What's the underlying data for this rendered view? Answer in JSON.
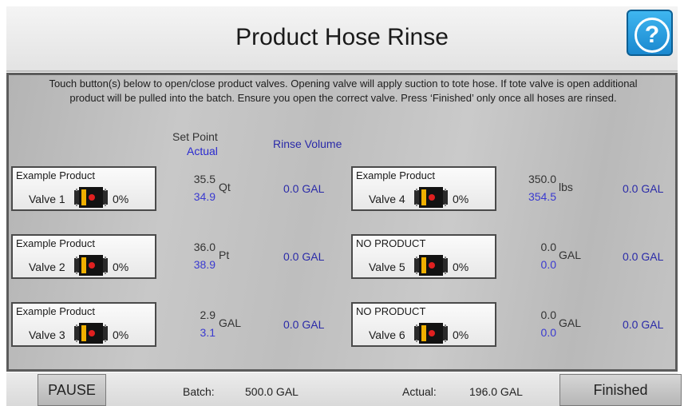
{
  "header": {
    "title": "Product Hose Rinse",
    "help_label": "?"
  },
  "instructions": "Touch button(s) below to open/close product valves.  Opening valve will apply suction to tote hose.  If tote valve is open additional product will be pulled into the batch.  Ensure you open the correct valve.  Press ‘Finished’ only once all hoses are rinsed.",
  "columns": {
    "set_point": "Set Point",
    "actual": "Actual",
    "rinse_volume": "Rinse Volume"
  },
  "colors": {
    "actual_value": "#3a3ad0",
    "rinse_value": "#2a2aa8",
    "help_button": "#1a88cf",
    "valve_indicator": "#e02020"
  },
  "valves": [
    {
      "product": "Example Product",
      "label": "Valve 1",
      "percent": "0%",
      "set_point": "35.5",
      "actual": "34.9",
      "unit": "Qt",
      "rinse": "0.0 GAL"
    },
    {
      "product": "Example Product",
      "label": "Valve 2",
      "percent": "0%",
      "set_point": "36.0",
      "actual": "38.9",
      "unit": "Pt",
      "rinse": "0.0 GAL"
    },
    {
      "product": "Example Product",
      "label": "Valve 3",
      "percent": "0%",
      "set_point": "2.9",
      "actual": "3.1",
      "unit": "GAL",
      "rinse": "0.0 GAL"
    },
    {
      "product": "Example Product",
      "label": "Valve 4",
      "percent": "0%",
      "set_point": "350.0",
      "actual": "354.5",
      "unit": "lbs",
      "rinse": "0.0 GAL"
    },
    {
      "product": "NO PRODUCT",
      "label": "Valve 5",
      "percent": "0%",
      "set_point": "0.0",
      "actual": "0.0",
      "unit": "GAL",
      "rinse": "0.0 GAL"
    },
    {
      "product": "NO PRODUCT",
      "label": "Valve 6",
      "percent": "0%",
      "set_point": "0.0",
      "actual": "0.0",
      "unit": "GAL",
      "rinse": "0.0 GAL"
    }
  ],
  "footer": {
    "pause_label": "PAUSE",
    "batch_label": "Batch:",
    "batch_value": "500.0 GAL",
    "actual_label": "Actual:",
    "actual_value": "196.0 GAL",
    "finished_label": "Finished"
  }
}
